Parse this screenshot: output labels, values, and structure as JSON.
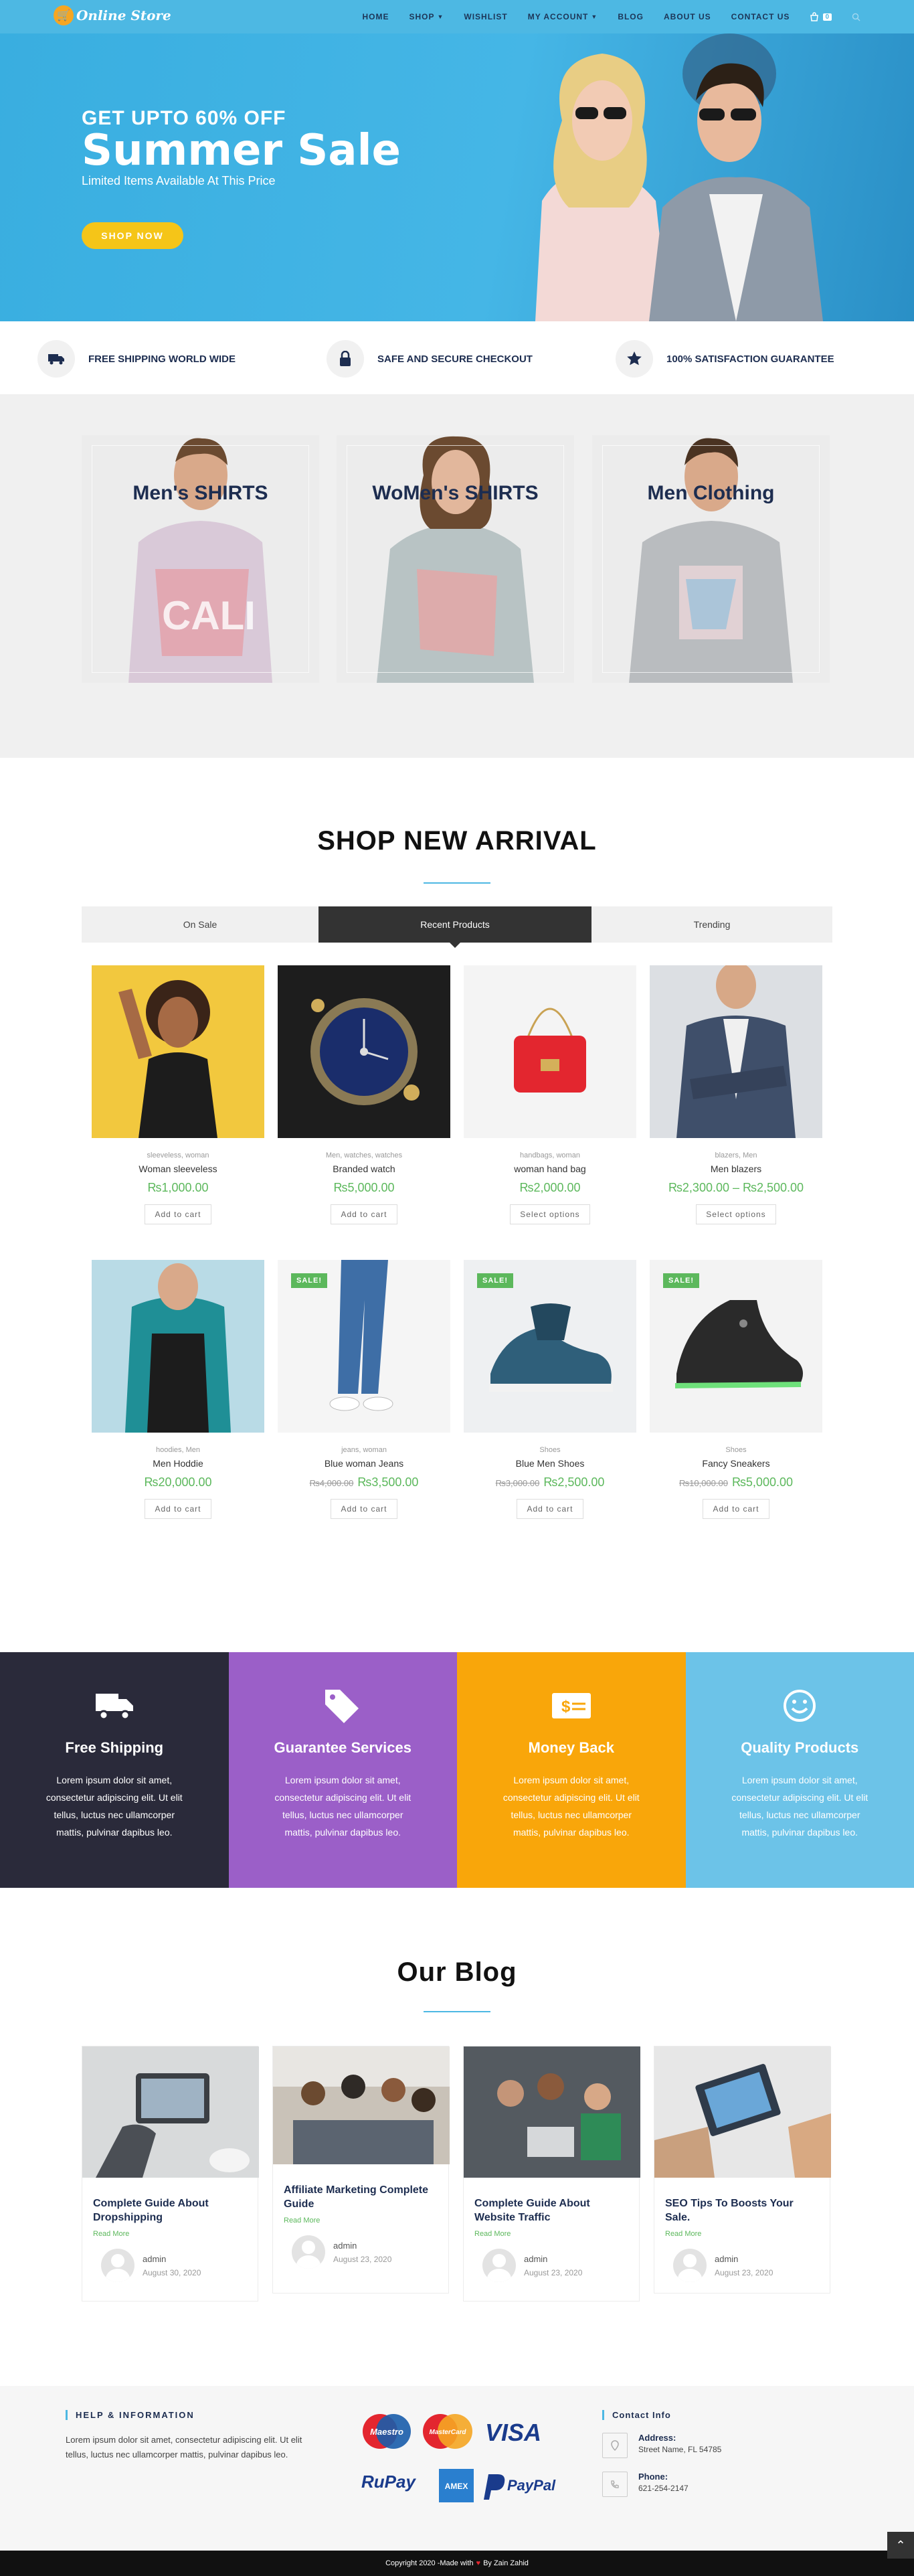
{
  "header": {
    "logo": "Online Store",
    "nav": [
      {
        "label": "HOME"
      },
      {
        "label": "SHOP"
      },
      {
        "label": "WISHLIST"
      },
      {
        "label": "MY ACCOUNT"
      },
      {
        "label": "BLOG"
      },
      {
        "label": "ABOUT US"
      },
      {
        "label": "CONTACT US"
      }
    ],
    "cart_count": "0"
  },
  "hero": {
    "tagline": "GET UPTO 60% OFF",
    "title": "Summer Sale",
    "subtitle": "Limited Items Available At This Price",
    "button": "SHOP NOW"
  },
  "features": [
    {
      "label": "FREE SHIPPING WORLD WIDE",
      "icon": "truck-icon"
    },
    {
      "label": "SAFE AND SECURE CHECKOUT",
      "icon": "lock-icon"
    },
    {
      "label": "100% SATISFACTION GUARANTEE",
      "icon": "star-icon"
    }
  ],
  "categories": [
    {
      "title": "Men's SHIRTS"
    },
    {
      "title": "WoMen's SHIRTS"
    },
    {
      "title": "Men Clothing"
    }
  ],
  "arrival": {
    "title": "SHOP NEW ARRIVAL",
    "tabs": [
      "On Sale",
      "Recent Products",
      "Trending"
    ],
    "products": [
      {
        "cats": "sleeveless, woman",
        "name": "Woman sleeveless",
        "price": "₨1,000.00",
        "old": "",
        "button": "Add to cart"
      },
      {
        "cats": "Men, watches, watches",
        "name": "Branded watch",
        "price": "₨5,000.00",
        "old": "",
        "button": "Add to cart"
      },
      {
        "cats": "handbags, woman",
        "name": "woman hand bag",
        "price": "₨2,000.00",
        "old": "",
        "button": "Select options"
      },
      {
        "cats": "blazers, Men",
        "name": "Men blazers",
        "price": "₨2,300.00 – ₨2,500.00",
        "old": "",
        "button": "Select options"
      },
      {
        "cats": "hoodies, Men",
        "name": "Men Hoddie",
        "price": "₨20,000.00",
        "old": "",
        "button": "Add to cart"
      },
      {
        "cats": "jeans, woman",
        "name": "Blue woman Jeans",
        "price": "₨3,500.00",
        "old": "₨4,000.00",
        "button": "Add to cart",
        "sale": "SALE!"
      },
      {
        "cats": "Shoes",
        "name": "Blue Men Shoes",
        "price": "₨2,500.00",
        "old": "₨3,000.00",
        "button": "Add to cart",
        "sale": "SALE!"
      },
      {
        "cats": "Shoes",
        "name": "Fancy Sneakers",
        "price": "₨5,000.00",
        "old": "₨10,000.00",
        "button": "Add to cart",
        "sale": "SALE!"
      }
    ]
  },
  "services": [
    {
      "title": "Free Shipping",
      "text": "Lorem ipsum dolor sit amet, consectetur adipiscing elit. Ut elit tellus, luctus nec ullamcorper mattis, pulvinar dapibus leo.",
      "color": "#2a2a3a",
      "icon": "truck-icon"
    },
    {
      "title": "Guarantee Services",
      "text": "Lorem ipsum dolor sit amet, consectetur adipiscing elit. Ut elit tellus, luctus nec ullamcorper mattis, pulvinar dapibus leo.",
      "color": "#9b5fc8",
      "icon": "tags-icon"
    },
    {
      "title": "Money Back",
      "text": "Lorem ipsum dolor sit amet, consectetur adipiscing elit. Ut elit tellus, luctus nec ullamcorper mattis, pulvinar dapibus leo.",
      "color": "#f9a60a",
      "icon": "money-icon"
    },
    {
      "title": "Quality Products",
      "text": "Lorem ipsum dolor sit amet, consectetur adipiscing elit. Ut elit tellus, luctus nec ullamcorper mattis, pulvinar dapibus leo.",
      "color": "#6cc3e8",
      "icon": "smile-icon"
    }
  ],
  "blog": {
    "title": "Our Blog",
    "read_more": "Read More",
    "posts": [
      {
        "title": "Complete Guide About Dropshipping",
        "author": "admin",
        "date": "August 30, 2020"
      },
      {
        "title": "Affiliate Marketing Complete Guide",
        "author": "admin",
        "date": "August 23, 2020"
      },
      {
        "title": "Complete Guide About Website Traffic",
        "author": "admin",
        "date": "August 23, 2020"
      },
      {
        "title": "SEO Tips To Boosts Your Sale.",
        "author": "admin",
        "date": "August 23, 2020"
      }
    ]
  },
  "footer": {
    "help_heading": "HELP & INFORMATION",
    "help_text": "Lorem ipsum dolor sit amet, consectetur adipiscing elit. Ut elit tellus, luctus nec ullamcorper mattis, pulvinar dapibus leo.",
    "payments": [
      "Maestro",
      "MasterCard",
      "VISA",
      "RuPay",
      "AMEX",
      "PayPal"
    ],
    "contact_heading": "Contact Info",
    "address_label": "Address:",
    "address": "Street Name, FL 54785",
    "phone_label": "Phone:",
    "phone": "621-254-2147",
    "copyright_pre": "Copyright 2020 -Made with",
    "copyright_post": "By Zain Zahid"
  }
}
